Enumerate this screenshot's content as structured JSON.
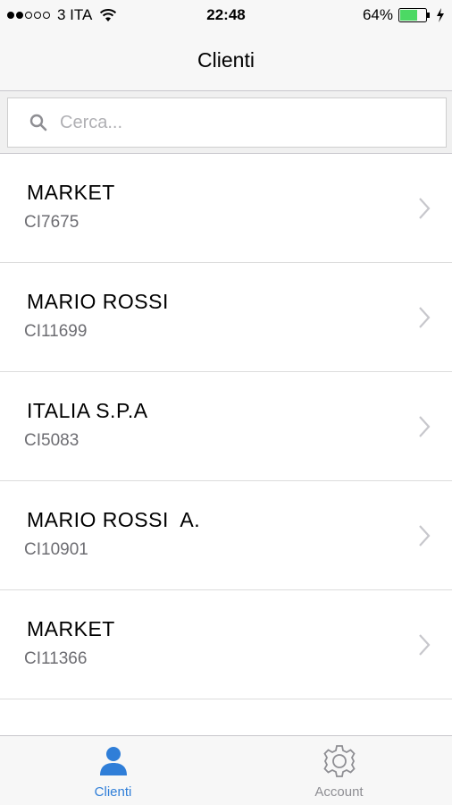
{
  "status_bar": {
    "carrier": "3 ITA",
    "time": "22:48",
    "battery_percent": "64%",
    "signal_bars_filled": 2,
    "signal_bars_total": 5
  },
  "nav": {
    "title": "Clienti"
  },
  "search": {
    "placeholder": "Cerca...",
    "value": ""
  },
  "clients": [
    {
      "name": "MARKET",
      "code": "CI7675"
    },
    {
      "name": "MARIO ROSSI",
      "code": "CI11699"
    },
    {
      "name": "ITALIA S.P.A",
      "code": "CI5083"
    },
    {
      "name": "MARIO ROSSI  A.",
      "code": "CI10901"
    },
    {
      "name": "MARKET",
      "code": "CI11366"
    }
  ],
  "tabs": [
    {
      "label": "Clienti",
      "icon": "person-icon",
      "active": true
    },
    {
      "label": "Account",
      "icon": "gear-icon",
      "active": false
    }
  ],
  "colors": {
    "accent": "#2f7ed8",
    "battery_fill": "#4cd964",
    "inactive_tab": "#8e8e93"
  }
}
